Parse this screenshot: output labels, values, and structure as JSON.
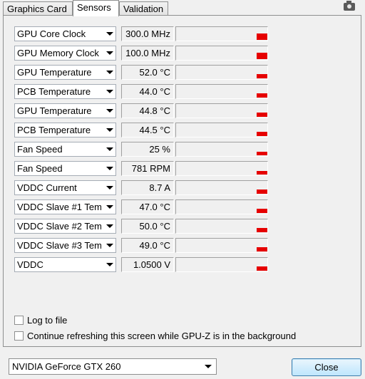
{
  "tabs": [
    {
      "label": "Graphics Card",
      "active": false
    },
    {
      "label": "Sensors",
      "active": true
    },
    {
      "label": "Validation",
      "active": false
    }
  ],
  "sensors": [
    {
      "name": "GPU Core Clock",
      "value": "300.0 MHz",
      "graph_level": 0.45
    },
    {
      "name": "GPU Memory Clock",
      "value": "100.0 MHz",
      "graph_level": 0.45
    },
    {
      "name": "GPU Temperature",
      "value": "52.0 °C",
      "graph_level": 0.3
    },
    {
      "name": "PCB Temperature",
      "value": "44.0 °C",
      "graph_level": 0.3
    },
    {
      "name": "GPU Temperature",
      "value": "44.8 °C",
      "graph_level": 0.3
    },
    {
      "name": "PCB Temperature",
      "value": "44.5 °C",
      "graph_level": 0.3
    },
    {
      "name": "Fan Speed",
      "value": "25 %",
      "graph_level": 0.25
    },
    {
      "name": "Fan Speed",
      "value": "781 RPM",
      "graph_level": 0.25
    },
    {
      "name": "VDDC Current",
      "value": "8.7 A",
      "graph_level": 0.3
    },
    {
      "name": "VDDC Slave #1 Tem…",
      "value": "47.0 °C",
      "graph_level": 0.3
    },
    {
      "name": "VDDC Slave #2 Tem…",
      "value": "50.0 °C",
      "graph_level": 0.3
    },
    {
      "name": "VDDC Slave #3 Tem…",
      "value": "49.0 °C",
      "graph_level": 0.3
    },
    {
      "name": "VDDC",
      "value": "1.0500 V",
      "graph_level": 0.3
    }
  ],
  "options": {
    "log_to_file": {
      "label": "Log to file",
      "checked": false
    },
    "continue_refreshing": {
      "label": "Continue refreshing this screen while GPU-Z is in the background",
      "checked": false
    }
  },
  "gpu_select": {
    "value": "NVIDIA GeForce GTX 260"
  },
  "close_label": "Close",
  "colors": {
    "graph_bar": "#e60000",
    "close_border": "#3c7fb1"
  },
  "icons": {
    "screenshot": "camera-icon"
  }
}
